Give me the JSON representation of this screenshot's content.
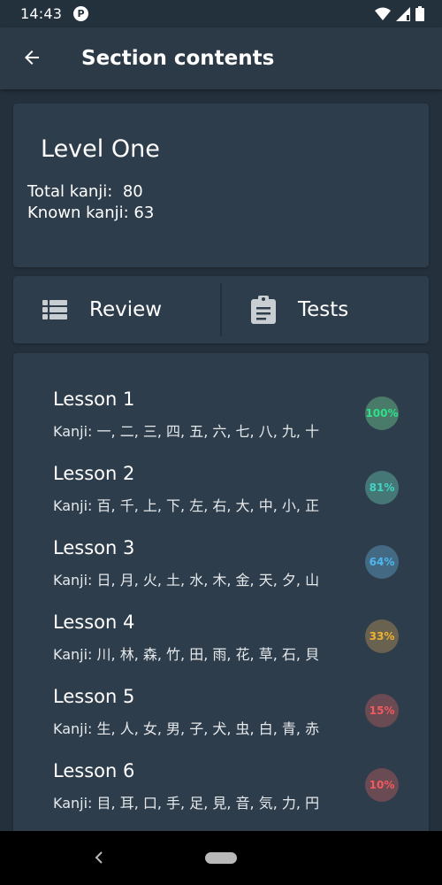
{
  "status_bar": {
    "time": "14:43",
    "app_icon_letter": "P",
    "icons": [
      "wifi-icon",
      "signal-icon",
      "battery-icon"
    ]
  },
  "app_bar": {
    "title": "Section contents",
    "back_icon": "arrow-back-icon"
  },
  "level": {
    "title": "Level One",
    "total_label": "Total kanji:  80",
    "known_label": "Known kanji: 63"
  },
  "actions": {
    "review_label": "Review",
    "review_icon": "list-icon",
    "tests_label": "Tests",
    "tests_icon": "clipboard-icon"
  },
  "lessons": [
    {
      "title": "Lesson 1",
      "kanji": "Kanji:  一, 二, 三, 四, 五, 六, 七, 八, 九, 十",
      "percent": "100%",
      "color": "#2ee089",
      "bg": "#4a7a6a"
    },
    {
      "title": "Lesson 2",
      "kanji": "Kanji:  百, 千, 上, 下, 左, 右, 大, 中, 小, 正",
      "percent": "81%",
      "color": "#42d6c2",
      "bg": "#467777"
    },
    {
      "title": "Lesson 3",
      "kanji": "Kanji:  日, 月, 火, 土, 水, 木, 金, 天, 夕, 山",
      "percent": "64%",
      "color": "#4fb7ef",
      "bg": "#436a82"
    },
    {
      "title": "Lesson 4",
      "kanji": "Kanji:  川, 林, 森, 竹, 田, 雨, 花, 草, 石, 貝",
      "percent": "33%",
      "color": "#f0b230",
      "bg": "#6a6250"
    },
    {
      "title": "Lesson 5",
      "kanji": "Kanji:  生, 人, 女, 男, 子, 犬, 虫, 白, 青, 赤",
      "percent": "15%",
      "color": "#f25a5f",
      "bg": "#6a4a53"
    },
    {
      "title": "Lesson 6",
      "kanji": "Kanji:  目, 耳, 口, 手, 足, 見, 音, 気, 力, 円",
      "percent": "10%",
      "color": "#f25a5f",
      "bg": "#6a4a53"
    }
  ],
  "nav_bar": {
    "back_icon": "nav-back-icon",
    "home_icon": "home-pill-icon"
  }
}
